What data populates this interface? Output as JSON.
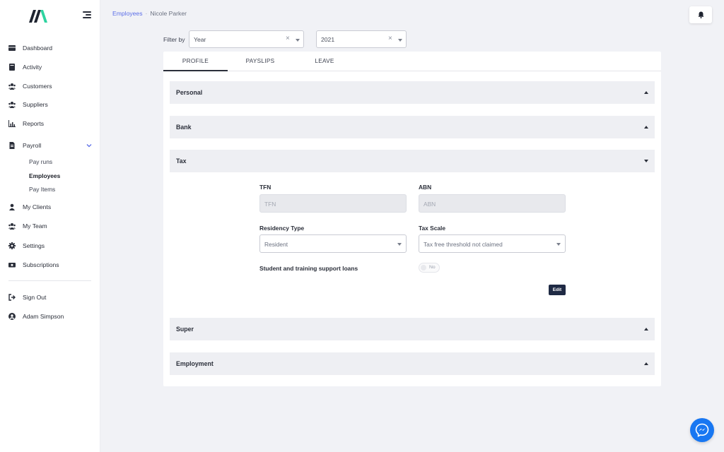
{
  "sidebar": {
    "items": [
      {
        "label": "Dashboard",
        "icon": "dashboard-icon"
      },
      {
        "label": "Activity",
        "icon": "activity-icon"
      },
      {
        "label": "Customers",
        "icon": "customers-icon"
      },
      {
        "label": "Suppliers",
        "icon": "suppliers-icon"
      },
      {
        "label": "Reports",
        "icon": "reports-icon"
      },
      {
        "label": "Payroll",
        "icon": "payroll-icon"
      },
      {
        "label": "My Clients",
        "icon": "user-icon"
      },
      {
        "label": "My Team",
        "icon": "team-icon"
      },
      {
        "label": "Settings",
        "icon": "gear-icon"
      },
      {
        "label": "Subscriptions",
        "icon": "subscriptions-icon"
      }
    ],
    "payroll_sub": [
      {
        "label": "Pay runs"
      },
      {
        "label": "Employees"
      },
      {
        "label": "Pay Items"
      }
    ],
    "bottom": [
      {
        "label": "Sign Out",
        "icon": "sign-out-icon"
      },
      {
        "label": "Adam Simpson",
        "icon": "account-icon"
      }
    ]
  },
  "breadcrumb": {
    "parent": "Employees",
    "separator": "·",
    "current": "Nicole Parker"
  },
  "filter": {
    "label": "Filter by",
    "type": {
      "value": "Year"
    },
    "year": {
      "value": "2021"
    },
    "clear_glyph": "×"
  },
  "tabs": [
    {
      "label": "PROFILE"
    },
    {
      "label": "PAYSLIPS"
    },
    {
      "label": "LEAVE"
    }
  ],
  "sections": {
    "personal": "Personal",
    "bank": "Bank",
    "tax": "Tax",
    "super": "Super",
    "employment": "Employment"
  },
  "tax": {
    "tfn_label": "TFN",
    "tfn_placeholder": "TFN",
    "abn_label": "ABN",
    "abn_placeholder": "ABN",
    "residency_label": "Residency Type",
    "residency_value": "Resident",
    "scale_label": "Tax Scale",
    "scale_value": "Tax free threshold not claimed",
    "loans_label": "Student and training support loans",
    "loans_toggle": "No",
    "edit_label": "Edit"
  },
  "colors": {
    "accent": "#5b6ee8",
    "brand_green": "#2ed3a0",
    "edit_button": "#1f2a44",
    "messenger": "#1877f2"
  }
}
